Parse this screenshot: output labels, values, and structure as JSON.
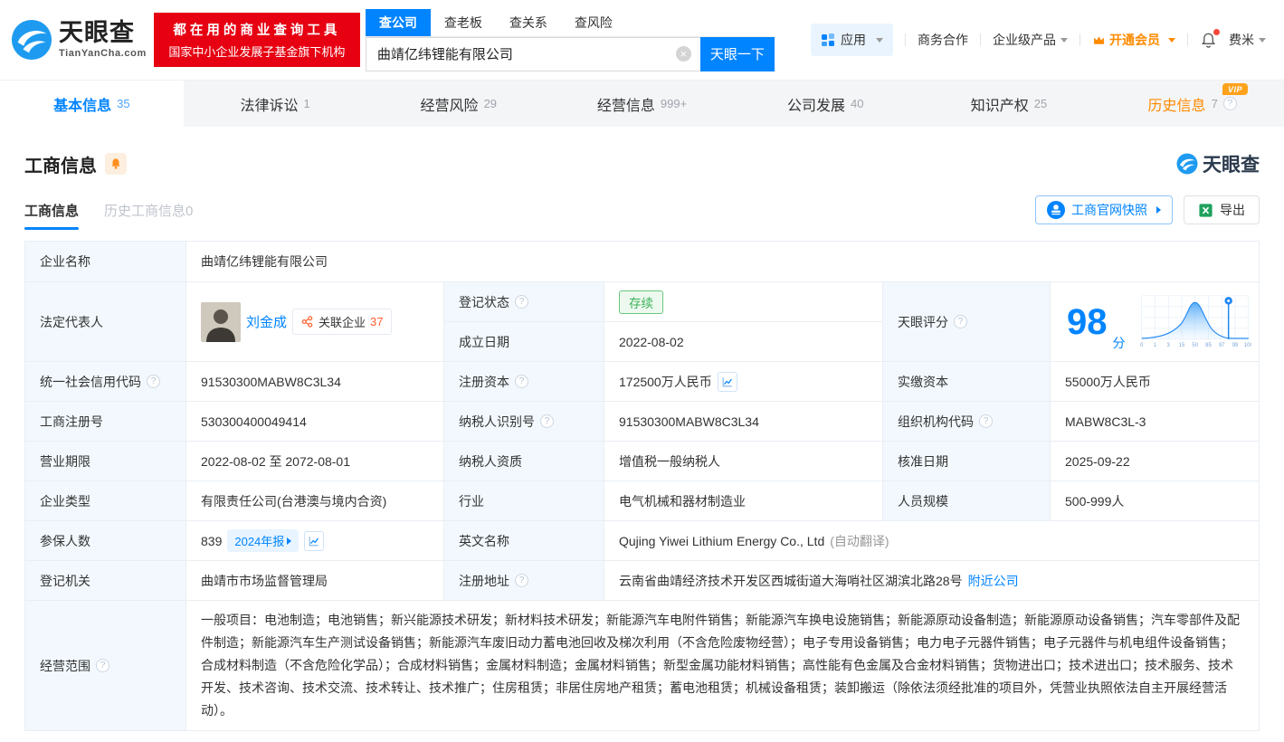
{
  "brand": {
    "name": "天眼查",
    "domain": "TianYanCha.com",
    "promo_line1": "都在用的商业查询工具",
    "promo_line2": "国家中小企业发展子基金旗下机构"
  },
  "search": {
    "tabs": [
      "查公司",
      "查老板",
      "查关系",
      "查风险"
    ],
    "value": "曲靖亿纬锂能有限公司",
    "button": "天眼一下"
  },
  "topnav": {
    "apps": "应用",
    "cooperation": "商务合作",
    "enterprise": "企业级产品",
    "vip": "开通会员",
    "username": "费米"
  },
  "company_tabs": [
    {
      "label": "基本信息",
      "count": "35"
    },
    {
      "label": "法律诉讼",
      "count": "1"
    },
    {
      "label": "经营风险",
      "count": "29"
    },
    {
      "label": "经营信息",
      "count": "999+"
    },
    {
      "label": "公司发展",
      "count": "40"
    },
    {
      "label": "知识产权",
      "count": "25"
    },
    {
      "label": "历史信息",
      "count": "7",
      "badge": "VIP"
    }
  ],
  "section": {
    "title": "工商信息",
    "brand": "天眼查",
    "subtab_active": "工商信息",
    "subtab_history": "历史工商信息0",
    "snapshot_btn": "工商官网快照",
    "export_btn": "导出"
  },
  "fields": {
    "company_name_label": "企业名称",
    "company_name": "曲靖亿纬锂能有限公司",
    "legal_rep_label": "法定代表人",
    "legal_rep_name": "刘金成",
    "related_label": "关联企业",
    "related_count": "37",
    "reg_status_label": "登记状态",
    "reg_status": "存续",
    "est_date_label": "成立日期",
    "est_date": "2022-08-02",
    "score_label": "天眼评分",
    "score": "98",
    "score_unit": "分",
    "credit_code_label": "统一社会信用代码",
    "credit_code": "91530300MABW8C3L34",
    "reg_capital_label": "注册资本",
    "reg_capital": "172500万人民币",
    "paid_capital_label": "实缴资本",
    "paid_capital": "55000万人民币",
    "reg_number_label": "工商注册号",
    "reg_number": "530300400049414",
    "taxpayer_id_label": "纳税人识别号",
    "taxpayer_id": "91530300MABW8C3L34",
    "org_code_label": "组织机构代码",
    "org_code": "MABW8C3L-3",
    "business_term_label": "营业期限",
    "business_term": "2022-08-02 至 2072-08-01",
    "taxpayer_quality_label": "纳税人资质",
    "taxpayer_quality": "增值税一般纳税人",
    "approval_date_label": "核准日期",
    "approval_date": "2025-09-22",
    "company_type_label": "企业类型",
    "company_type": "有限责任公司(台港澳与境内合资)",
    "industry_label": "行业",
    "industry": "电气机械和器材制造业",
    "staff_size_label": "人员规模",
    "staff_size": "500-999人",
    "insured_label": "参保人数",
    "insured_count": "839",
    "insured_report": "2024年报",
    "english_name_label": "英文名称",
    "english_name": "Qujing Yiwei Lithium Energy Co., Ltd",
    "english_name_note": "(自动翻译)",
    "registry_label": "登记机关",
    "registry": "曲靖市市场监督管理局",
    "address_label": "注册地址",
    "address": "云南省曲靖经济技术开发区西城街道大海哨社区湖滨北路28号",
    "nearby_link": "附近公司",
    "scope_label": "经营范围",
    "scope": "一般项目：电池制造；电池销售；新兴能源技术研发；新材料技术研发；新能源汽车电附件销售；新能源汽车换电设施销售；新能源原动设备制造；新能源原动设备销售；汽车零部件及配件制造；新能源汽车生产测试设备销售；新能源汽车废旧动力蓄电池回收及梯次利用（不含危险废物经营）；电子专用设备销售；电力电子元器件销售；电子元器件与机电组件设备销售；合成材料制造（不含危险化学品）；合成材料销售；金属材料制造；金属材料销售；新型金属功能材料销售；高性能有色金属及合金材料销售；货物进出口；技术进出口；技术服务、技术开发、技术咨询、技术交流、技术转让、技术推广；住房租赁；非居住房地产租赁；蓄电池租赁；机械设备租赁；装卸搬运（除依法须经批准的项目外，凭营业执照依法自主开展经营活动）。"
  },
  "chart_data": {
    "type": "area",
    "title": "天眼评分分布曲线",
    "x": [
      "0",
      "1",
      "3",
      "15",
      "50",
      "85",
      "97",
      "99",
      "100"
    ],
    "marker_value": 98
  }
}
